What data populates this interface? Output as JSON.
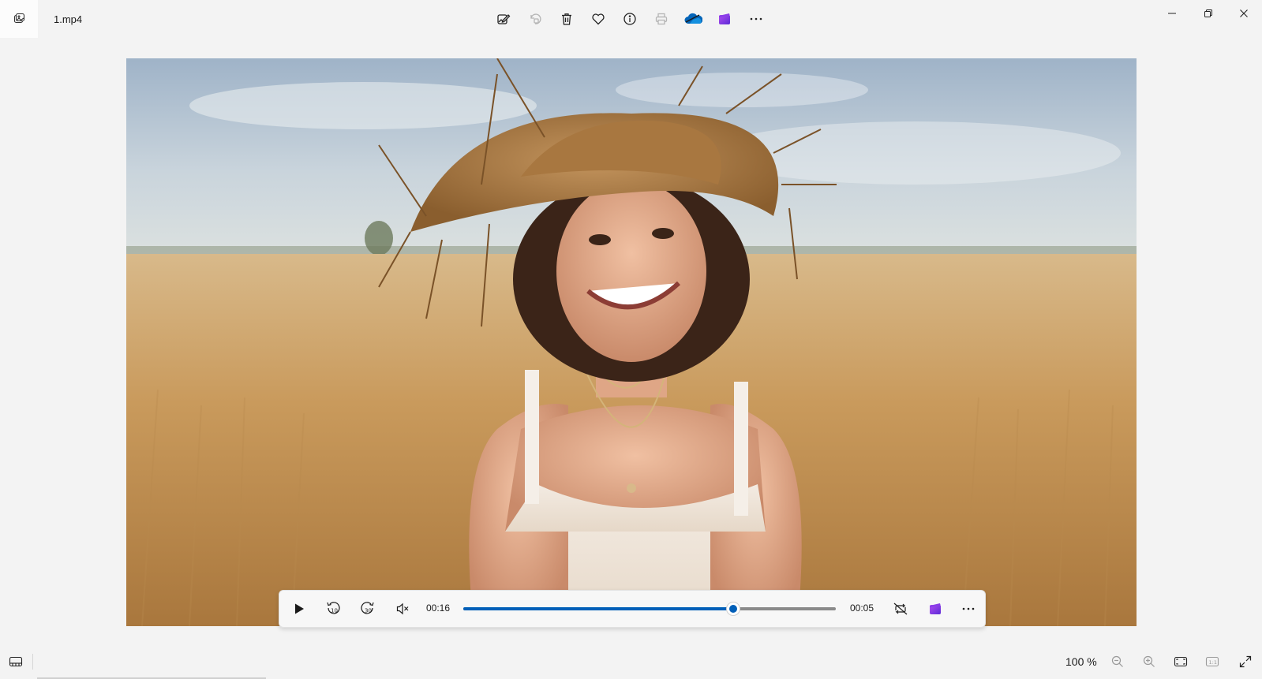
{
  "window": {
    "title": "1.mp4",
    "app_icon": "photos-app-icon",
    "controls": [
      "minimize-icon",
      "restore-icon",
      "close-icon"
    ]
  },
  "toolbar": {
    "items": [
      {
        "name": "edit-image-icon",
        "label": "Edit image"
      },
      {
        "name": "rotate-icon",
        "label": "Rotate"
      },
      {
        "name": "delete-icon",
        "label": "Delete"
      },
      {
        "name": "favorite-icon",
        "label": "Favorite"
      },
      {
        "name": "file-info-icon",
        "label": "File information"
      },
      {
        "name": "print-icon",
        "label": "Print"
      },
      {
        "name": "onedrive-icon",
        "label": "OneDrive"
      },
      {
        "name": "clipchamp-icon",
        "label": "Clipchamp"
      },
      {
        "name": "more-options-icon",
        "label": "See more"
      }
    ]
  },
  "player": {
    "elapsed": "00:16",
    "remaining": "00:05",
    "progress": 0.725,
    "state": "paused",
    "muted": true,
    "buttons": [
      "play-icon",
      "rewind-10-icon",
      "forward-30-icon",
      "mute-icon",
      "repeat-off-icon",
      "clipchamp-icon",
      "more-options-icon"
    ]
  },
  "statusbar": {
    "zoom": "100 %",
    "buttons": [
      "filmstrip-icon",
      "zoom-out-icon",
      "zoom-in-icon",
      "fit-to-window-icon",
      "actual-size-icon",
      "full-screen-icon"
    ]
  },
  "colors": {
    "accent": "#005fb8",
    "background": "#f3f3f3"
  }
}
